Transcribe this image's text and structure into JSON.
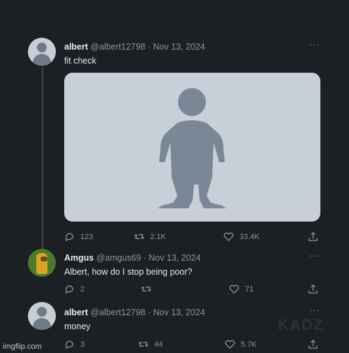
{
  "tweets": [
    {
      "name": "albert",
      "handle": "@albert12798",
      "date": "· Nov 13, 2024",
      "text": "fit check",
      "avatar": "default-profile-icon",
      "has_media": true,
      "stats": {
        "replies": "123",
        "retweets": "2.1K",
        "likes": "33.4K"
      }
    },
    {
      "name": "Amgus",
      "handle": "@amgus69",
      "date": "· Nov 13, 2024",
      "text": "Albert, how do I stop being poor?",
      "avatar": "amgus-avatar",
      "stats": {
        "replies": "2",
        "retweets": "",
        "likes": "71"
      }
    },
    {
      "name": "albert",
      "handle": "@albert12798",
      "date": "· Nov 13, 2024",
      "text": "money",
      "avatar": "default-profile-icon",
      "stats": {
        "replies": "3",
        "retweets": "44",
        "likes": "5.7K"
      }
    }
  ],
  "watermarks": {
    "kadz": "KADZ",
    "imgflip": "imgflip.com"
  },
  "colors": {
    "background": "#1c1f23",
    "text": "#e7e9ea",
    "muted": "#8b949c",
    "media_bg": "#c9cfd8",
    "figure": "#7a8796"
  },
  "icons": {
    "more": "more-icon",
    "reply": "reply-icon",
    "retweet": "retweet-icon",
    "like": "like-icon",
    "share": "share-icon"
  }
}
